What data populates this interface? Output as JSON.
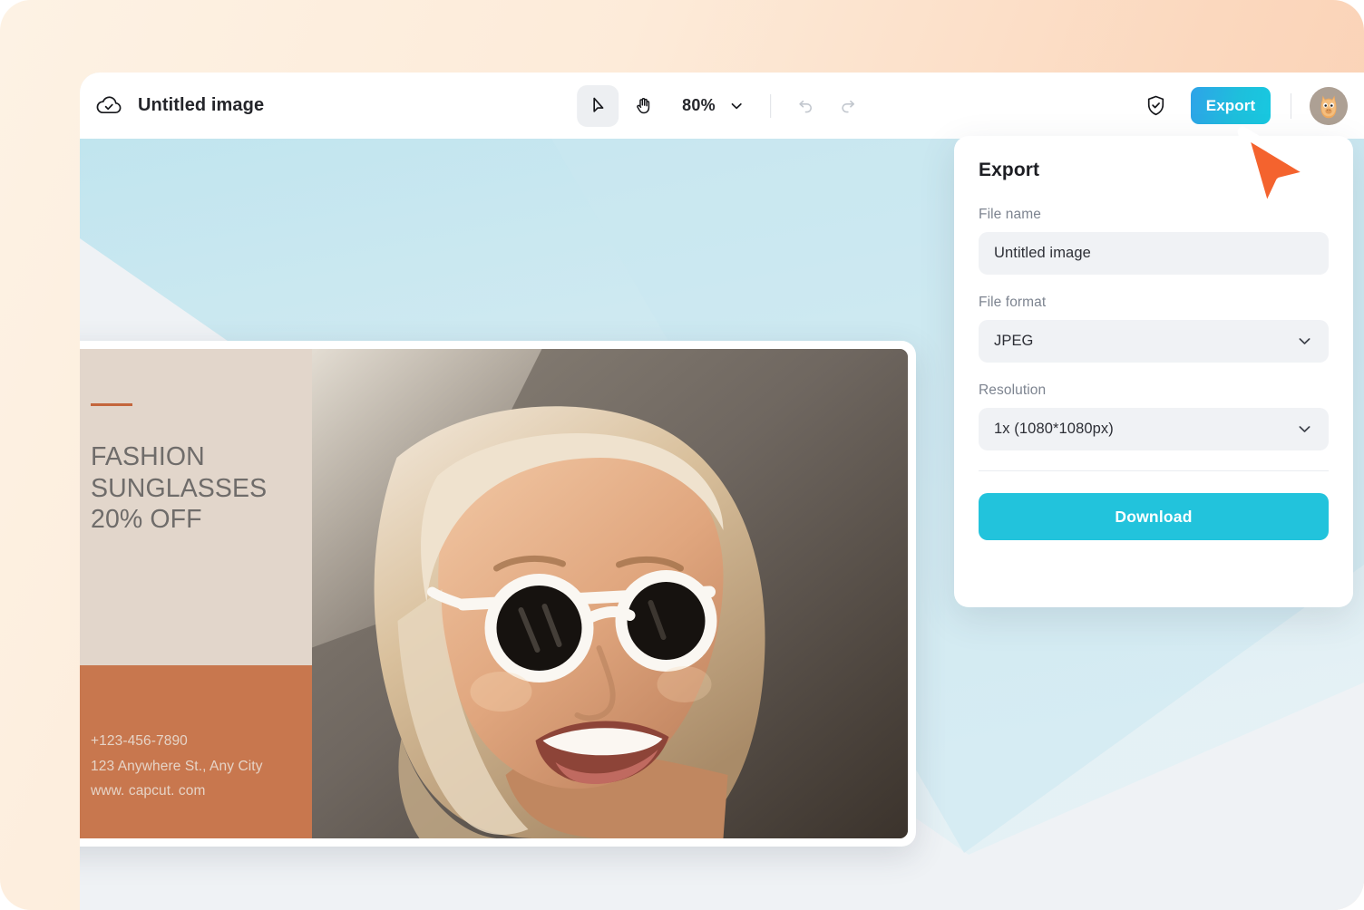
{
  "window": {
    "title": "Untitled image",
    "cloud_icon": "cloud-check-icon"
  },
  "toolbar": {
    "select_tool": "select-cursor-tool",
    "hand_tool": "hand-pan-tool",
    "zoom_level": "80%",
    "zoom_chevron": "chevron-down-icon",
    "undo": "undo-arrow-icon",
    "redo": "redo-arrow-icon",
    "shield": "shield-check-icon",
    "export_label": "Export",
    "avatar": "user-avatar"
  },
  "export_panel": {
    "title": "Export",
    "file_name_label": "File name",
    "file_name_value": "Untitled image",
    "file_name_placeholder": "Untitled image",
    "file_format_label": "File format",
    "file_format_value": "JPEG",
    "resolution_label": "Resolution",
    "resolution_value": "1x (1080*1080px)",
    "download_label": "Download"
  },
  "design": {
    "accent_color": "#C4663C",
    "headline": "FASHION\nSUNGLASSES\n20% OFF",
    "contact": [
      "+123-456-7890",
      "123 Anywhere St., Any City",
      "www. capcut. com"
    ]
  },
  "colors": {
    "background_peach": "#FDEBD9",
    "canvas_gray": "#EFF2F5",
    "beam_blue": "#CDE9F1",
    "export_gradient_start": "#2EA3E8",
    "export_gradient_end": "#18C8E0",
    "download_cyan": "#22C3DC",
    "design_beige": "#E2D6CB",
    "design_terracotta": "#C8774E",
    "cursor_orange": "#F4632E"
  }
}
